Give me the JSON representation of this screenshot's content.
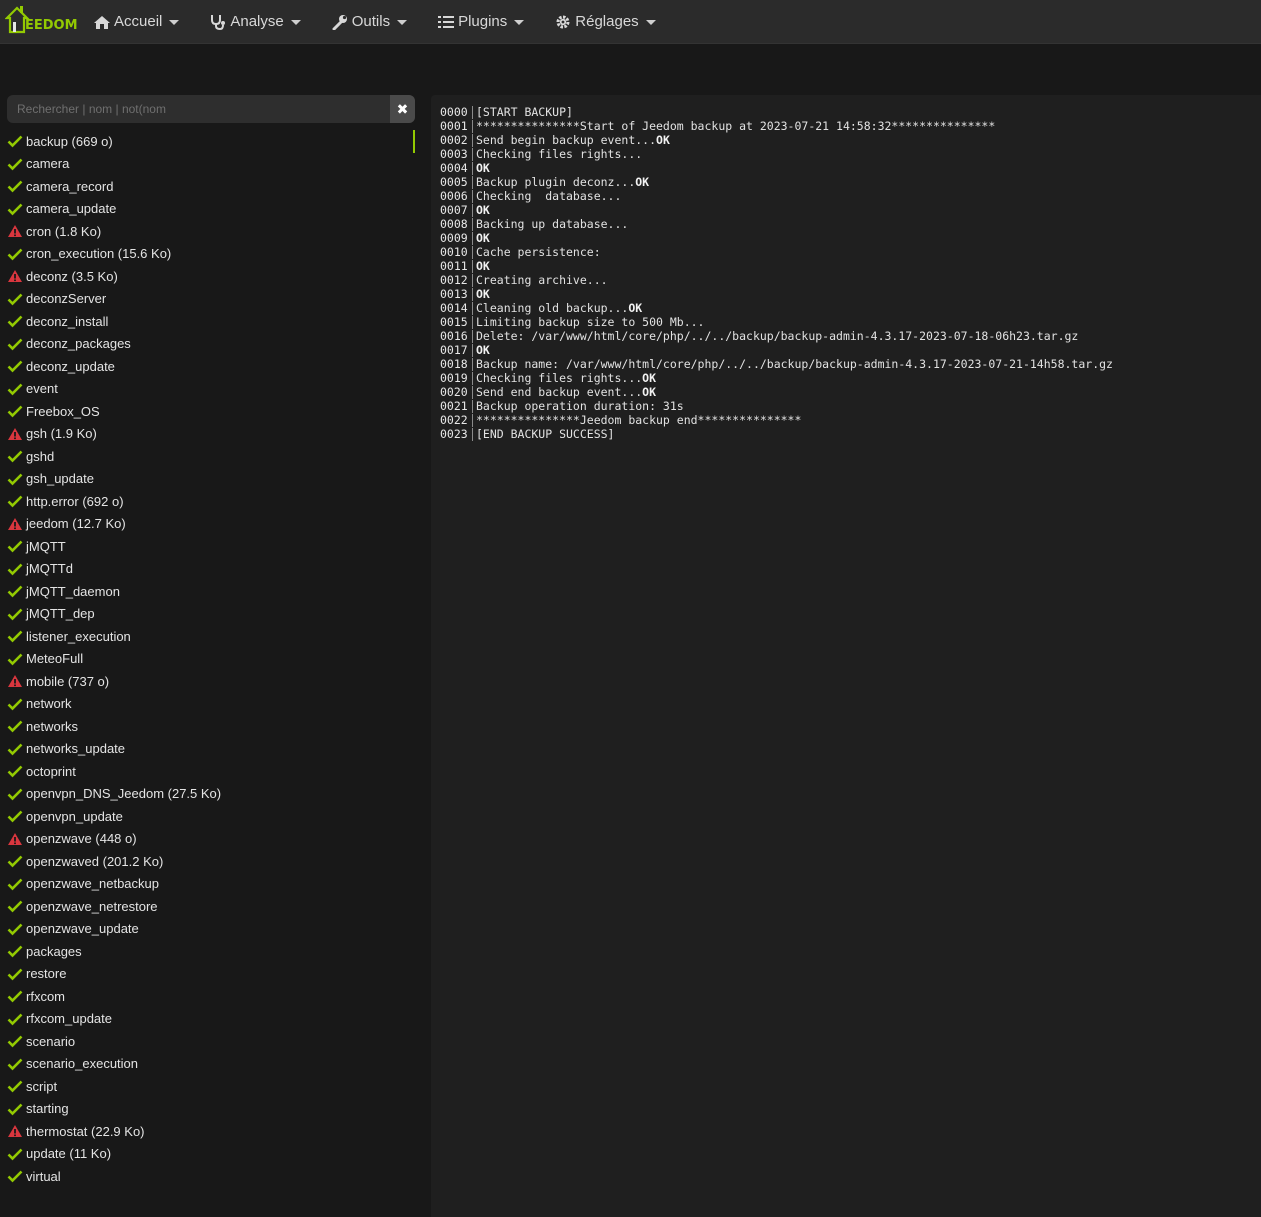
{
  "app": {
    "logo_text": "EEDOM"
  },
  "nav": [
    {
      "label": "Accueil",
      "icon": "home-icon"
    },
    {
      "label": "Analyse",
      "icon": "stethoscope-icon"
    },
    {
      "label": "Outils",
      "icon": "wrench-icon"
    },
    {
      "label": "Plugins",
      "icon": "list-icon"
    },
    {
      "label": "Réglages",
      "icon": "gear-icon"
    }
  ],
  "search": {
    "placeholder": "Rechercher | nom | not(nom",
    "clear_label": "✖"
  },
  "colors": {
    "accent": "#93ca02",
    "ok": "#93ca02",
    "warning": "#d9363e"
  },
  "logs": [
    {
      "name": "backup (669 o)",
      "status": "ok",
      "active": true
    },
    {
      "name": "camera",
      "status": "ok"
    },
    {
      "name": "camera_record",
      "status": "ok"
    },
    {
      "name": "camera_update",
      "status": "ok"
    },
    {
      "name": "cron (1.8 Ko)",
      "status": "warning"
    },
    {
      "name": "cron_execution (15.6 Ko)",
      "status": "ok"
    },
    {
      "name": "deconz (3.5 Ko)",
      "status": "warning"
    },
    {
      "name": "deconzServer",
      "status": "ok"
    },
    {
      "name": "deconz_install",
      "status": "ok"
    },
    {
      "name": "deconz_packages",
      "status": "ok"
    },
    {
      "name": "deconz_update",
      "status": "ok"
    },
    {
      "name": "event",
      "status": "ok"
    },
    {
      "name": "Freebox_OS",
      "status": "ok"
    },
    {
      "name": "gsh (1.9 Ko)",
      "status": "warning"
    },
    {
      "name": "gshd",
      "status": "ok"
    },
    {
      "name": "gsh_update",
      "status": "ok"
    },
    {
      "name": "http.error (692 o)",
      "status": "ok"
    },
    {
      "name": "jeedom (12.7 Ko)",
      "status": "warning"
    },
    {
      "name": "jMQTT",
      "status": "ok"
    },
    {
      "name": "jMQTTd",
      "status": "ok"
    },
    {
      "name": "jMQTT_daemon",
      "status": "ok"
    },
    {
      "name": "jMQTT_dep",
      "status": "ok"
    },
    {
      "name": "listener_execution",
      "status": "ok"
    },
    {
      "name": "MeteoFull",
      "status": "ok"
    },
    {
      "name": "mobile (737 o)",
      "status": "warning"
    },
    {
      "name": "network",
      "status": "ok"
    },
    {
      "name": "networks",
      "status": "ok"
    },
    {
      "name": "networks_update",
      "status": "ok"
    },
    {
      "name": "octoprint",
      "status": "ok"
    },
    {
      "name": "openvpn_DNS_Jeedom (27.5 Ko)",
      "status": "ok"
    },
    {
      "name": "openvpn_update",
      "status": "ok"
    },
    {
      "name": "openzwave (448 o)",
      "status": "warning"
    },
    {
      "name": "openzwaved (201.2 Ko)",
      "status": "ok"
    },
    {
      "name": "openzwave_netbackup",
      "status": "ok"
    },
    {
      "name": "openzwave_netrestore",
      "status": "ok"
    },
    {
      "name": "openzwave_update",
      "status": "ok"
    },
    {
      "name": "packages",
      "status": "ok"
    },
    {
      "name": "restore",
      "status": "ok"
    },
    {
      "name": "rfxcom",
      "status": "ok"
    },
    {
      "name": "rfxcom_update",
      "status": "ok"
    },
    {
      "name": "scenario",
      "status": "ok"
    },
    {
      "name": "scenario_execution",
      "status": "ok"
    },
    {
      "name": "script",
      "status": "ok"
    },
    {
      "name": "starting",
      "status": "ok"
    },
    {
      "name": "thermostat (22.9 Ko)",
      "status": "warning"
    },
    {
      "name": "update (11 Ko)",
      "status": "ok"
    },
    {
      "name": "virtual",
      "status": "ok"
    }
  ],
  "log_lines": [
    {
      "num": "0000",
      "text": "[START BACKUP]",
      "bold": ""
    },
    {
      "num": "0001",
      "text": "***************Start of Jeedom backup at 2023-07-21 14:58:32***************",
      "bold": ""
    },
    {
      "num": "0002",
      "text": "Send begin backup event...",
      "bold": "OK"
    },
    {
      "num": "0003",
      "text": "Checking files rights...",
      "bold": ""
    },
    {
      "num": "0004",
      "text": "",
      "bold": "OK"
    },
    {
      "num": "0005",
      "text": "Backup plugin deconz...",
      "bold": "OK"
    },
    {
      "num": "0006",
      "text": "Checking  database...",
      "bold": ""
    },
    {
      "num": "0007",
      "text": "",
      "bold": "OK"
    },
    {
      "num": "0008",
      "text": "Backing up database...",
      "bold": ""
    },
    {
      "num": "0009",
      "text": "",
      "bold": "OK"
    },
    {
      "num": "0010",
      "text": "Cache persistence:",
      "bold": ""
    },
    {
      "num": "0011",
      "text": "",
      "bold": "OK"
    },
    {
      "num": "0012",
      "text": "Creating archive...",
      "bold": ""
    },
    {
      "num": "0013",
      "text": "",
      "bold": "OK"
    },
    {
      "num": "0014",
      "text": "Cleaning old backup...",
      "bold": "OK"
    },
    {
      "num": "0015",
      "text": "Limiting backup size to 500 Mb...",
      "bold": ""
    },
    {
      "num": "0016",
      "text": "Delete: /var/www/html/core/php/../../backup/backup-admin-4.3.17-2023-07-18-06h23.tar.gz",
      "bold": ""
    },
    {
      "num": "0017",
      "text": "",
      "bold": "OK"
    },
    {
      "num": "0018",
      "text": "Backup name: /var/www/html/core/php/../../backup/backup-admin-4.3.17-2023-07-21-14h58.tar.gz",
      "bold": ""
    },
    {
      "num": "0019",
      "text": "Checking files rights...",
      "bold": "OK"
    },
    {
      "num": "0020",
      "text": "Send end backup event...",
      "bold": "OK"
    },
    {
      "num": "0021",
      "text": "Backup operation duration: 31s",
      "bold": ""
    },
    {
      "num": "0022",
      "text": "***************Jeedom backup end***************",
      "bold": ""
    },
    {
      "num": "0023",
      "text": "[END BACKUP SUCCESS]",
      "bold": ""
    }
  ]
}
